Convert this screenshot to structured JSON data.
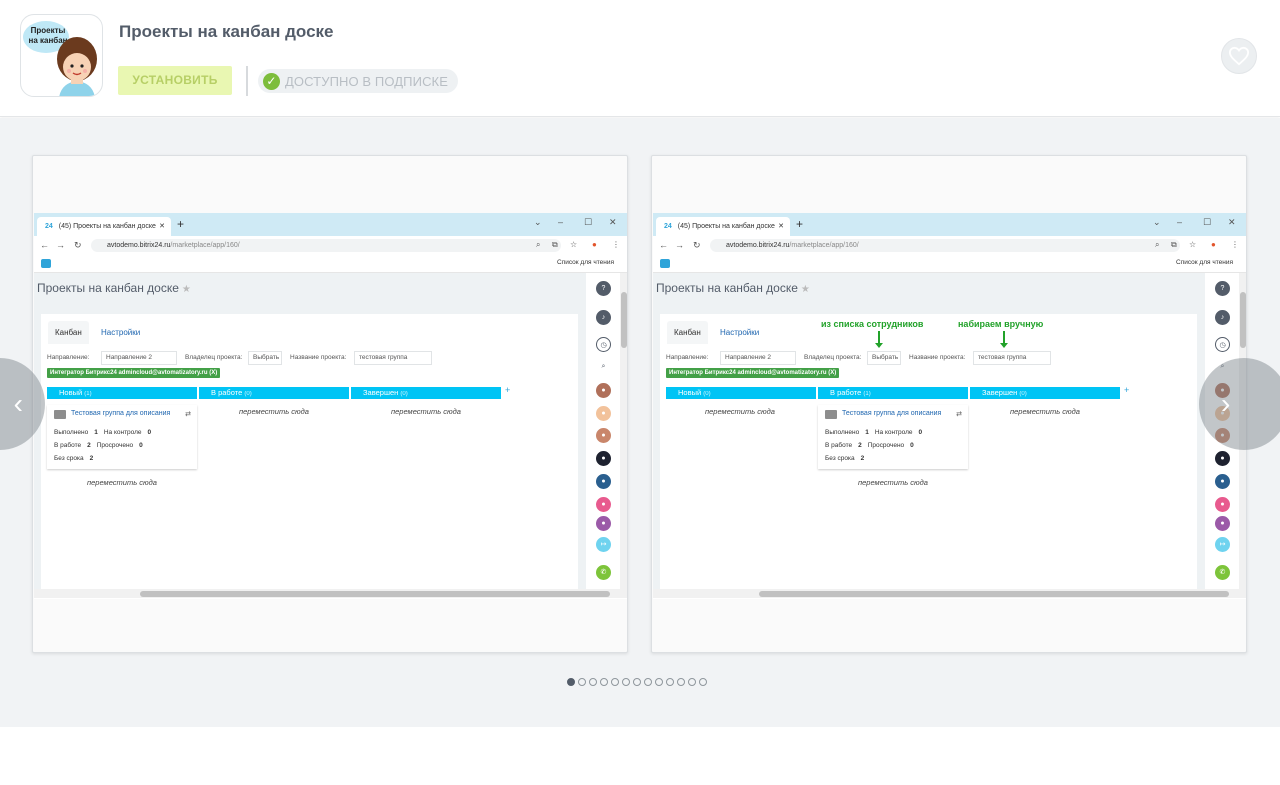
{
  "app": {
    "title": "Проекты на канбан доске",
    "icon_text": "Проекты на канбан",
    "install_label": "УСТАНОВИТЬ",
    "subscription_label": "ДОСТУПНО В ПОДПИСКЕ",
    "favorite_icon": "heart-icon"
  },
  "gallery": {
    "current_slide": 1,
    "slide_count": 13,
    "slides": [
      {
        "tab_title": "(45) Проекты на канбан доске",
        "tab_logo": "24",
        "url_host": "avtodemo.bitrix24.ru",
        "url_path": "/marketplace/app/160/",
        "reading_list": "Список для чтения",
        "page_title": "Проекты на канбан доске",
        "subtabs": [
          "Канбан",
          "Настройки"
        ],
        "filters": {
          "direction_label": "Направление:",
          "direction_value": "Направление 2",
          "owner_label": "Владелец проекта:",
          "owner_value": "Выбрать",
          "name_label": "Название проекта:",
          "name_value": "тестовая группа"
        },
        "badge": "Интегратор Битрикс24 admincloud@avtomatizatory.ru (X)",
        "columns": [
          {
            "name": "Новый",
            "count": "(1)"
          },
          {
            "name": "В работе",
            "count": "(0)"
          },
          {
            "name": "Завершен",
            "count": "(0)"
          }
        ],
        "card": {
          "title": "Тестовая группа для описания",
          "done_label": "Выполнено",
          "done": "1",
          "control_label": "На контроле",
          "control": "0",
          "work_label": "В работе",
          "work": "2",
          "overdue_label": "Просрочено",
          "overdue": "0",
          "nodeadline_label": "Без срока",
          "nodeadline": "2"
        },
        "move_here": "переместить сюда",
        "annotations": []
      },
      {
        "tab_title": "(45) Проекты на канбан доске",
        "tab_logo": "24",
        "url_host": "avtodemo.bitrix24.ru",
        "url_path": "/marketplace/app/160/",
        "reading_list": "Список для чтения",
        "page_title": "Проекты на канбан доске",
        "subtabs": [
          "Канбан",
          "Настройки"
        ],
        "filters": {
          "direction_label": "Направление:",
          "direction_value": "Направление 2",
          "owner_label": "Владелец проекта:",
          "owner_value": "Выбрать",
          "name_label": "Название проекта:",
          "name_value": "тестовая группа"
        },
        "badge": "Интегратор Битрикс24 admincloud@avtomatizatory.ru (X)",
        "columns": [
          {
            "name": "Новый",
            "count": "(0)"
          },
          {
            "name": "В работе",
            "count": "(1)"
          },
          {
            "name": "Завершен",
            "count": "(0)"
          }
        ],
        "card": {
          "title": "Тестовая группа для описания",
          "done_label": "Выполнено",
          "done": "1",
          "control_label": "На контроле",
          "control": "0",
          "work_label": "В работе",
          "work": "2",
          "overdue_label": "Просрочено",
          "overdue": "0",
          "nodeadline_label": "Без срока",
          "nodeadline": "2"
        },
        "move_here": "переместить сюда",
        "annotations": [
          "из списка сотрудников",
          "набираем вручную"
        ]
      }
    ]
  },
  "colors": {
    "install_bg": "#e9f7b2",
    "install_text": "#b7cf66",
    "check_green": "#7dbd3c",
    "kanban_header": "#00c4f5",
    "annotation_green": "#22a22a",
    "badge_green": "#43a047"
  }
}
